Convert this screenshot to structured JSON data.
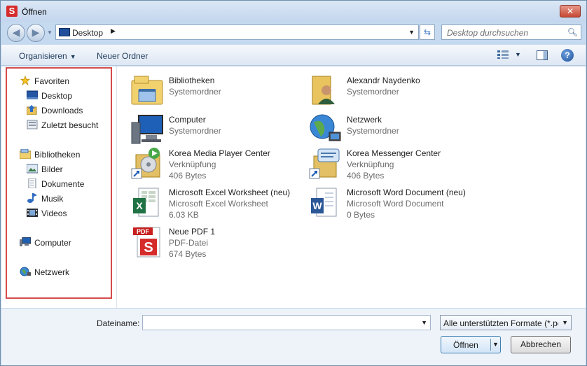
{
  "window": {
    "title": "Öffnen",
    "app_icon_letter": "S",
    "close_glyph": "✕"
  },
  "nav": {
    "back_glyph": "◀",
    "forward_glyph": "▶",
    "address": "Desktop",
    "search_placeholder": "Desktop durchsuchen"
  },
  "toolbar": {
    "organise": "Organisieren",
    "new_folder": "Neuer Ordner",
    "help": "?"
  },
  "sidebar": {
    "favorites": "Favoriten",
    "desktop": "Desktop",
    "downloads": "Downloads",
    "recent": "Zuletzt besucht",
    "libraries": "Bibliotheken",
    "pictures": "Bilder",
    "documents": "Dokumente",
    "music": "Musik",
    "videos": "Videos",
    "computer": "Computer",
    "network": "Netzwerk"
  },
  "files": [
    {
      "name": "Bibliotheken",
      "type": "Systemordner",
      "size": "",
      "icon": "libraries-icon"
    },
    {
      "name": "Alexandr Naydenko",
      "type": "Systemordner",
      "size": "",
      "icon": "user-folder-icon"
    },
    {
      "name": "Computer",
      "type": "Systemordner",
      "size": "",
      "icon": "computer-icon"
    },
    {
      "name": "Netzwerk",
      "type": "Systemordner",
      "size": "",
      "icon": "network-icon"
    },
    {
      "name": "Korea Media Player Center",
      "type": "Verknüpfung",
      "size": "406 Bytes",
      "icon": "media-player-shortcut-icon"
    },
    {
      "name": "Korea Messenger Center",
      "type": "Verknüpfung",
      "size": "406 Bytes",
      "icon": "messenger-shortcut-icon"
    },
    {
      "name": "Microsoft Excel Worksheet (neu)",
      "type": "Microsoft Excel Worksheet",
      "size": "6.03 KB",
      "icon": "excel-icon"
    },
    {
      "name": "Microsoft Word Document (neu)",
      "type": "Microsoft Word Document",
      "size": "0 Bytes",
      "icon": "word-icon"
    },
    {
      "name": "Neue PDF 1",
      "type": "PDF-Datei",
      "size": "674 Bytes",
      "icon": "pdf-icon"
    }
  ],
  "bottom": {
    "filename_label": "Dateiname:",
    "filename_value": "",
    "filter": "Alle unterstützten Formate (*.pdf)",
    "open_label": "Öffnen",
    "cancel_label": "Abbrechen"
  },
  "colors": {
    "accent": "#d64b4b",
    "window_frame": "#c5d9ef"
  }
}
